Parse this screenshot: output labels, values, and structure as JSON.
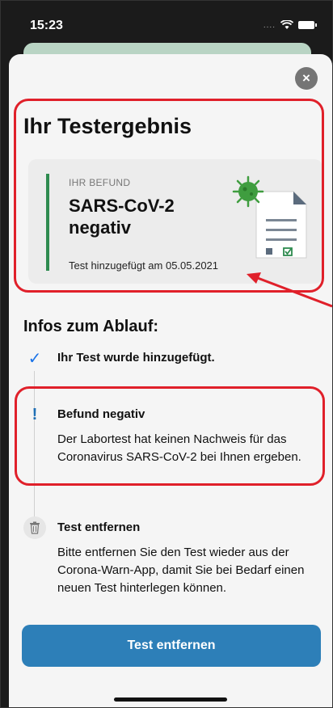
{
  "status_bar": {
    "time": "15:23",
    "signal": "....",
    "wifi_icon": "wifi-icon",
    "battery_icon": "battery-icon"
  },
  "sheet": {
    "close_icon": "close-icon",
    "title": "Ihr Testergebnis",
    "result_card": {
      "label": "IHR BEFUND",
      "result_line1": "SARS-CoV-2",
      "result_line2": "negativ",
      "added_text": "Test hinzugefügt am 05.05.2021",
      "accent_color": "#2e8b4f"
    },
    "infos_title": "Infos zum Ablauf:",
    "steps": [
      {
        "icon": "check-icon",
        "title": "Ihr Test wurde hinzugefügt."
      },
      {
        "icon": "exclamation-icon",
        "title": "Befund negativ",
        "body": "Der Labortest hat keinen Nachweis für das Coronavirus SARS-CoV-2 bei Ihnen ergeben."
      },
      {
        "icon": "trash-icon",
        "title": "Test entfernen",
        "body": "Bitte entfernen Sie den Test wieder aus der Corona-Warn-App, damit Sie bei Bedarf einen neuen Test hinterlegen können."
      }
    ],
    "remove_button": {
      "label": "Test entfernen",
      "color": "#2d7fb8"
    }
  },
  "annotations": {
    "highlight_color": "#e0202a"
  }
}
